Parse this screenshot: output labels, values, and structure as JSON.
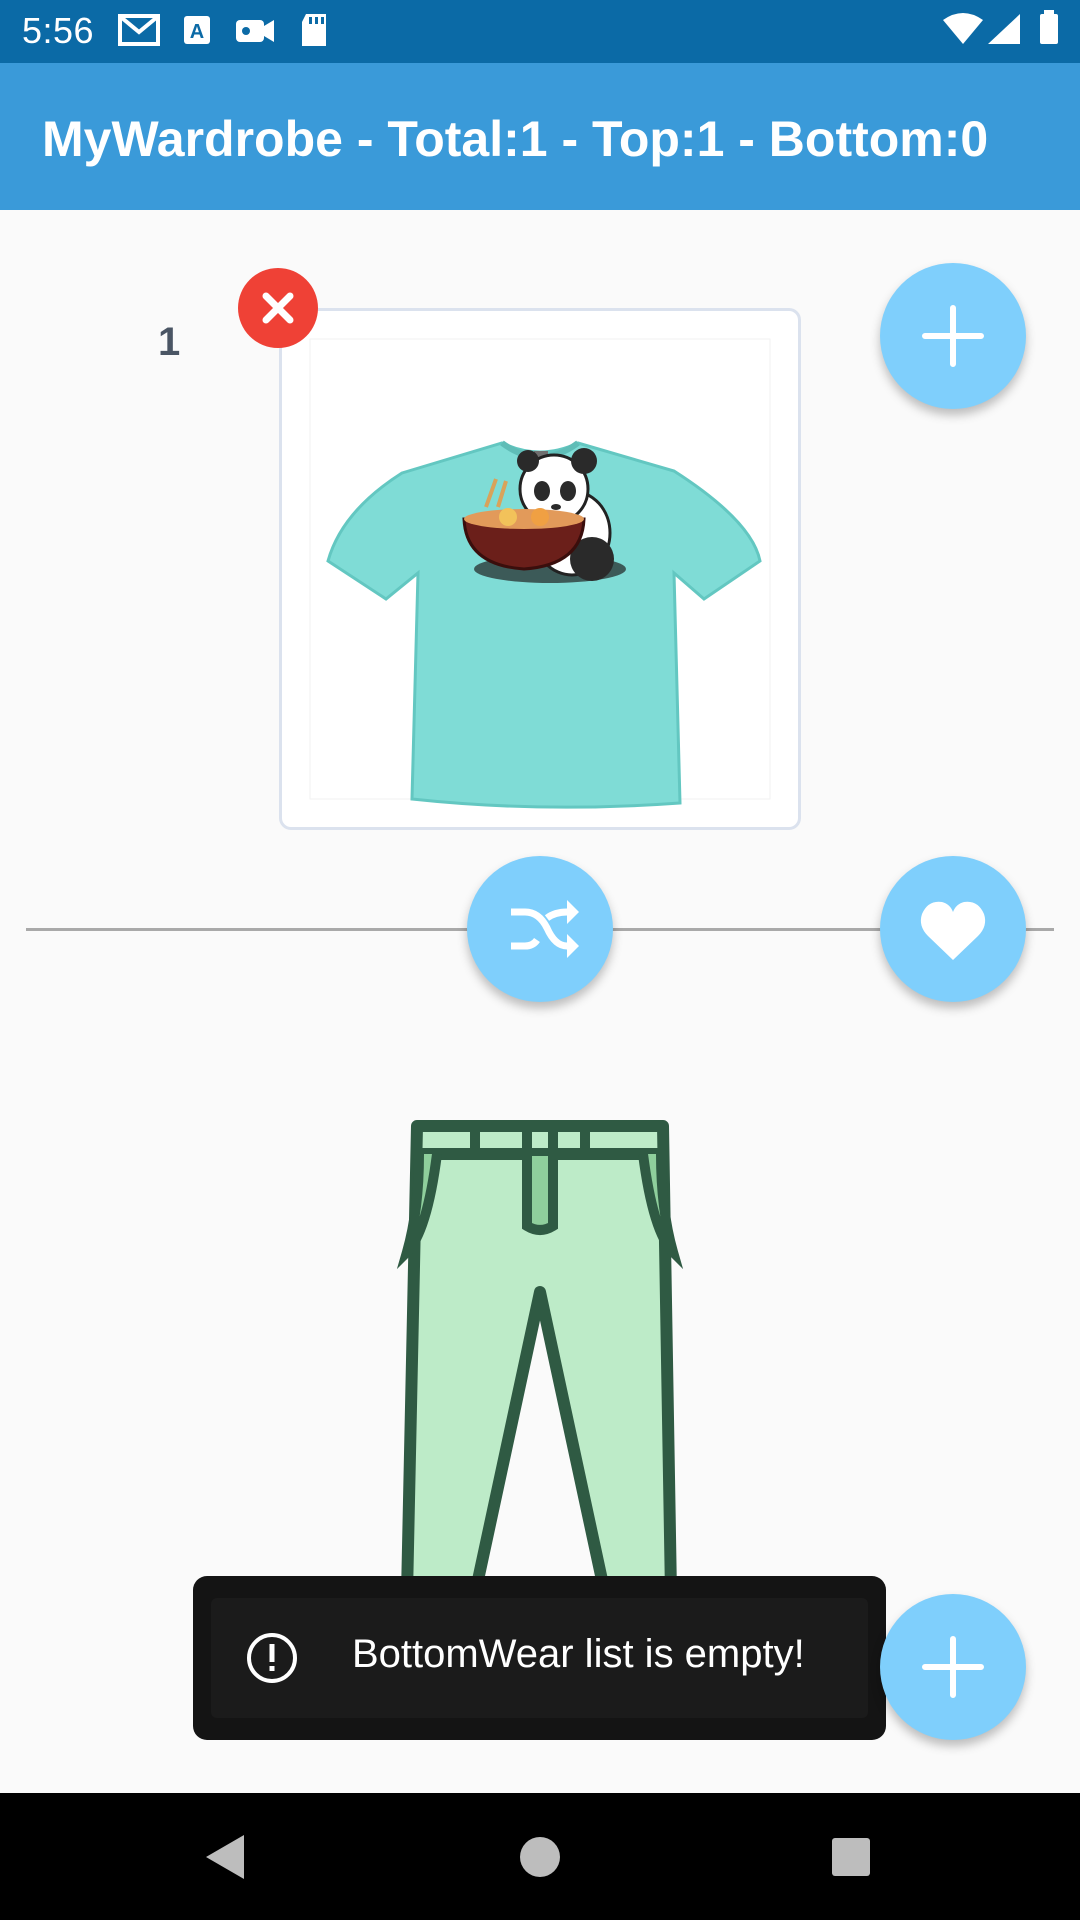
{
  "status_bar": {
    "time": "5:56",
    "icons": [
      "gmail-icon",
      "a-icon",
      "video-camera-icon",
      "sd-card-icon",
      "wifi-icon",
      "signal-icon",
      "battery-icon"
    ]
  },
  "app_bar": {
    "title": "MyWardrobe - Total:1 - Top:1 - Bottom:0"
  },
  "top_section": {
    "index": "1",
    "image": "t-shirt-panda-image",
    "remove_icon": "close-icon",
    "add_icon": "plus-icon"
  },
  "actions": {
    "shuffle_icon": "shuffle-icon",
    "favorite_icon": "heart-icon"
  },
  "bottom_section": {
    "placeholder": "pants-placeholder-image",
    "add_icon": "plus-icon"
  },
  "snackbar": {
    "icon": "alert-circle-icon",
    "message": "BottomWear list is empty!"
  },
  "nav_bar": {
    "icons": [
      "back-icon",
      "home-icon",
      "recents-icon"
    ]
  },
  "colors": {
    "status_bar": "#0b6aa6",
    "app_bar": "#3a9ad9",
    "fab": "#7fcffc",
    "remove": "#ef4136",
    "snackbar": "#141414"
  }
}
